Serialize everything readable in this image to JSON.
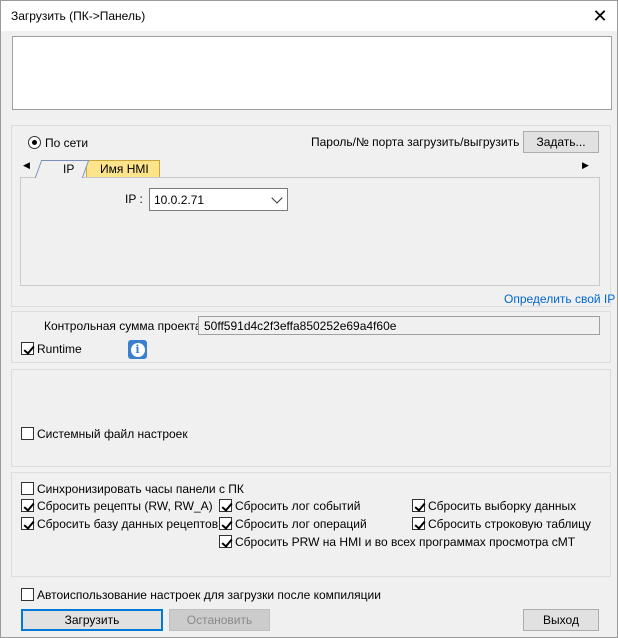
{
  "window": {
    "title": "Загрузить (ПК->Панель)",
    "close_glyph": "✕"
  },
  "connection": {
    "network_label": "По сети",
    "password_label": "Пароль/№ порта загрузить/выгрузить :",
    "set_button": "Задать...",
    "tabs": [
      {
        "label": "IP"
      },
      {
        "label": "Имя HMI"
      }
    ],
    "ip_label": "IP :",
    "ip_value": "10.0.2.71",
    "detect_ip_link": "Определить свой IP"
  },
  "checksum": {
    "label": "Контрольная сумма проекта :",
    "value": "50ff591d4c2f3effa850252e69a4f60e",
    "runtime_label": "Runtime",
    "runtime_checked": true
  },
  "system": {
    "settings_file_label": "Системный файл настроек",
    "settings_file_checked": false
  },
  "options": {
    "sync_clock": {
      "label": "Синхронизировать часы панели с ПК",
      "checked": false
    },
    "reset_recipes": {
      "label": "Сбросить рецепты (RW, RW_A)",
      "checked": true
    },
    "reset_recipe_db": {
      "label": "Сбросить базу данных рецептов",
      "checked": true
    },
    "reset_event_log": {
      "label": "Сбросить лог событий",
      "checked": true
    },
    "reset_operation_log": {
      "label": "Сбросить лог операций",
      "checked": true
    },
    "reset_prw": {
      "label": "Сбросить PRW на HMI и во всех программах просмотра cMT",
      "checked": true
    },
    "reset_data_sampling": {
      "label": "Сбросить выборку данных",
      "checked": true
    },
    "reset_string_table": {
      "label": "Сбросить строковую таблицу",
      "checked": true
    }
  },
  "footer": {
    "auto_use_label": "Автоиспользование настроек для загрузки после компиляции",
    "auto_use_checked": false,
    "download_button": "Загрузить",
    "stop_button": "Остановить",
    "exit_button": "Выход"
  }
}
